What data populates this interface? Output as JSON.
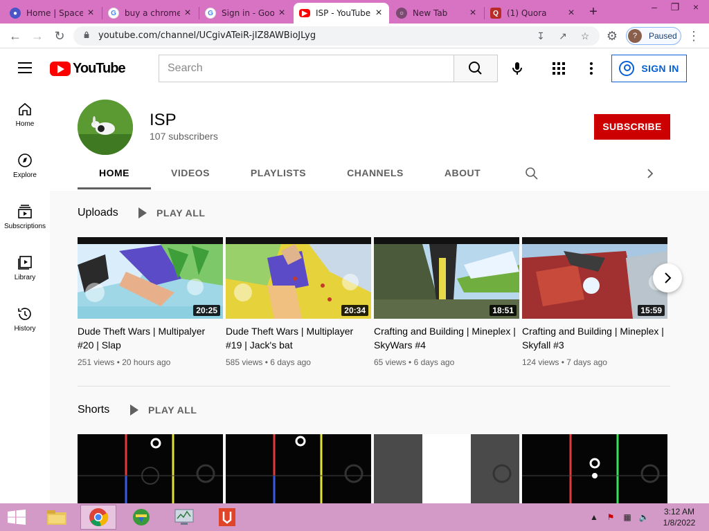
{
  "browser": {
    "tabs": [
      {
        "title": "Home | Space",
        "favicon": "space-icon",
        "active": false
      },
      {
        "title": "buy a chrome",
        "favicon": "google-icon",
        "active": false
      },
      {
        "title": "Sign in - Goo",
        "favicon": "google-icon",
        "active": false
      },
      {
        "title": "ISP - YouTube",
        "favicon": "youtube-icon",
        "active": true
      },
      {
        "title": "New Tab",
        "favicon": "chrome-icon",
        "active": false
      },
      {
        "title": "(1) Quora",
        "favicon": "quora-icon",
        "active": false
      }
    ],
    "url": "youtube.com/channel/UCgivATeiR-jIZ8AWBioJLyg",
    "profile": {
      "initial": "?",
      "status": "Paused"
    }
  },
  "youtube": {
    "logo": "YouTube",
    "search_placeholder": "Search",
    "signin_label": "SIGN IN",
    "rail": [
      {
        "label": "Home",
        "icon": "home-icon"
      },
      {
        "label": "Explore",
        "icon": "compass-icon"
      },
      {
        "label": "Subscriptions",
        "icon": "subscriptions-icon"
      },
      {
        "label": "Library",
        "icon": "library-icon"
      },
      {
        "label": "History",
        "icon": "history-icon"
      }
    ]
  },
  "channel": {
    "name": "ISP",
    "subscribers": "107 subscribers",
    "subscribe_label": "SUBSCRIBE",
    "tabs": [
      "HOME",
      "VIDEOS",
      "PLAYLISTS",
      "CHANNELS",
      "ABOUT"
    ],
    "active_tab": "HOME"
  },
  "uploads": {
    "title": "Uploads",
    "play_all": "PLAY ALL",
    "videos": [
      {
        "title": "Dude Theft Wars | Multipalyer #20 | Slap",
        "duration": "20:25",
        "views": "251 views",
        "age": "20 hours ago"
      },
      {
        "title": "Dude Theft Wars | Multiplayer #19 | Jack's bat",
        "duration": "20:34",
        "views": "585 views",
        "age": "6 days ago"
      },
      {
        "title": "Crafting and Building | Mineplex | SkyWars #4",
        "duration": "18:51",
        "views": "65 views",
        "age": "6 days ago"
      },
      {
        "title": "Crafting and Building | Mineplex | Skyfall #3",
        "duration": "15:59",
        "views": "124 views",
        "age": "7 days ago"
      }
    ]
  },
  "shorts": {
    "title": "Shorts",
    "play_all": "PLAY ALL"
  },
  "taskbar": {
    "time": "3:12 AM",
    "date": "1/8/2022"
  },
  "colors": {
    "tab_strip": "#d873c4",
    "youtube_red": "#ff0000",
    "subscribe_red": "#cc0000",
    "link_blue": "#065fd4",
    "taskbar": "#d39ac8"
  }
}
